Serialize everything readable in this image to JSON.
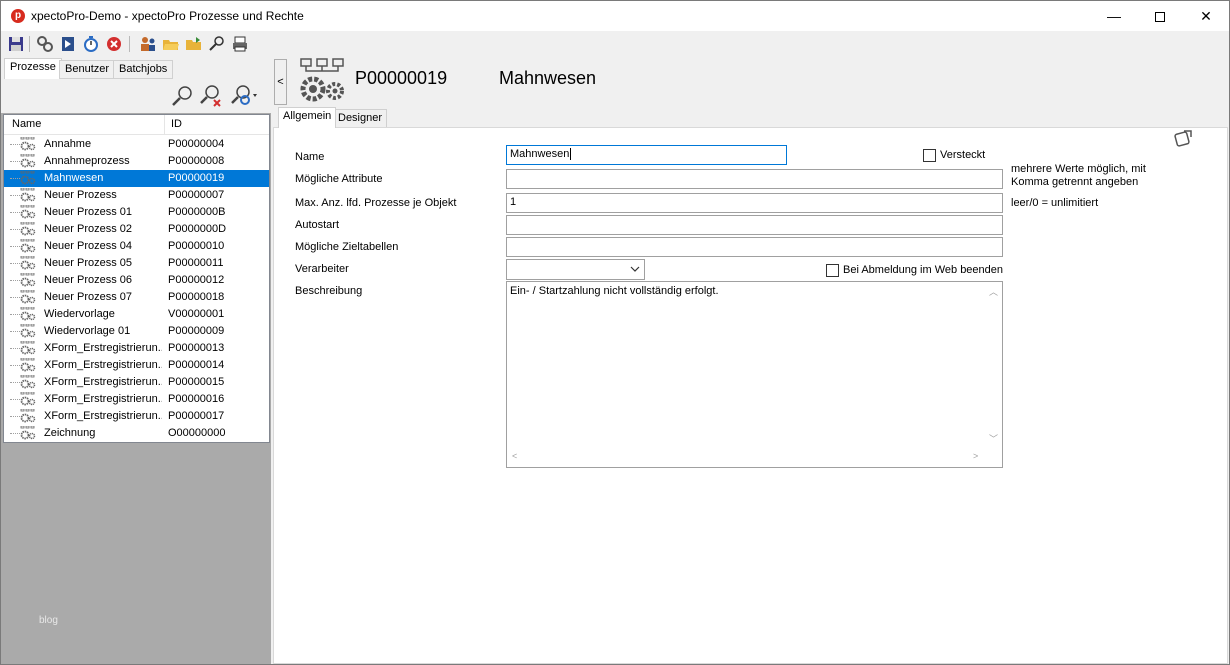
{
  "window": {
    "title": "xpectoPro-Demo - xpectoPro Prozesse und Rechte",
    "app_icon_letter": "p",
    "minimize": "—",
    "close": "✕"
  },
  "toolbar": {
    "icons": [
      "save-icon",
      "gears-icon",
      "run-icon",
      "timer-icon",
      "cancel-icon",
      "users-icon",
      "open-folder-icon",
      "folder-icon",
      "search-icon",
      "print-icon"
    ]
  },
  "left_tabs": [
    "Prozesse",
    "Benutzer",
    "Batchjobs"
  ],
  "list": {
    "col_name": "Name",
    "col_id": "ID",
    "rows": [
      {
        "name": "Annahme",
        "id": "P00000004"
      },
      {
        "name": "Annahmeprozess",
        "id": "P00000008"
      },
      {
        "name": "Mahnwesen",
        "id": "P00000019",
        "selected": true
      },
      {
        "name": "Neuer Prozess",
        "id": "P00000007"
      },
      {
        "name": "Neuer Prozess 01",
        "id": "P0000000B"
      },
      {
        "name": "Neuer Prozess 02",
        "id": "P0000000D"
      },
      {
        "name": "Neuer Prozess 04",
        "id": "P00000010"
      },
      {
        "name": "Neuer Prozess 05",
        "id": "P00000011"
      },
      {
        "name": "Neuer Prozess 06",
        "id": "P00000012"
      },
      {
        "name": "Neuer Prozess 07",
        "id": "P00000018"
      },
      {
        "name": "Wiedervorlage",
        "id": "V00000001"
      },
      {
        "name": "Wiedervorlage 01",
        "id": "P00000009"
      },
      {
        "name": "XForm_Erstregistrierun...",
        "id": "P00000013"
      },
      {
        "name": "XForm_Erstregistrierun...",
        "id": "P00000014"
      },
      {
        "name": "XForm_Erstregistrierun...",
        "id": "P00000015"
      },
      {
        "name": "XForm_Erstregistrierun...",
        "id": "P00000016"
      },
      {
        "name": "XForm_Erstregistrierun...",
        "id": "P00000017"
      },
      {
        "name": "Zeichnung",
        "id": "O00000000"
      }
    ]
  },
  "watermark": "blog",
  "collapse_glyph": "<",
  "header": {
    "id": "P00000019",
    "name": "Mahnwesen"
  },
  "right_tabs": [
    "Allgemein",
    "Designer"
  ],
  "form": {
    "name_label": "Name",
    "name_value": "Mahnwesen",
    "hidden_label": "Versteckt",
    "attributes_label": "Mögliche Attribute",
    "attributes_value": "",
    "attributes_hint_1": "mehrere Werte möglich, mit",
    "attributes_hint_2": "Komma getrennt angeben",
    "max_label": "Max. Anz. lfd. Prozesse je Objekt",
    "max_value": "1",
    "max_hint": "leer/0 = unlimitiert",
    "autostart_label": "Autostart",
    "autostart_value": "",
    "target_tables_label": "Mögliche Zieltabellen",
    "target_tables_value": "",
    "processor_label": "Verarbeiter",
    "processor_value": "",
    "logout_label": "Bei Abmeldung im Web beenden",
    "description_label": "Beschreibung",
    "description_value": "Ein- / Startzahlung nicht vollständig erfolgt."
  }
}
